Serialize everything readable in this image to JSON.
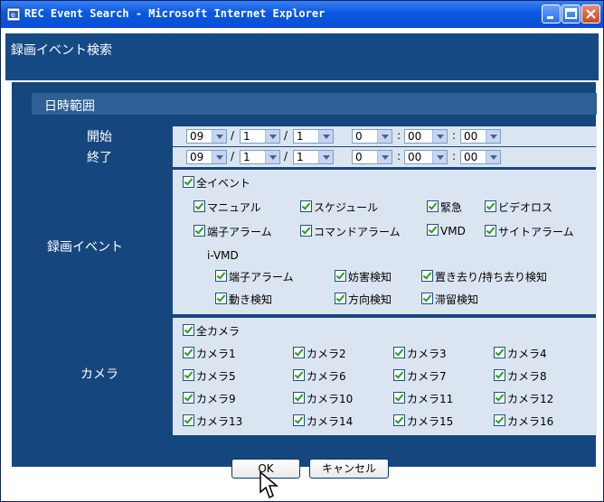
{
  "window": {
    "title": "REC Event Search - Microsoft Internet Explorer"
  },
  "page": {
    "title": "録画イベント検索"
  },
  "section": {
    "title": "日時範囲"
  },
  "rows": {
    "start_label": "開始",
    "end_label": "終了",
    "events_label": "録画イベント",
    "camera_label": "カメラ"
  },
  "start": {
    "year": "09",
    "month": "1",
    "day": "1",
    "hour": "0",
    "minute": "00",
    "second": "00"
  },
  "end": {
    "year": "09",
    "month": "1",
    "day": "1",
    "hour": "0",
    "minute": "00",
    "second": "00"
  },
  "separators": {
    "slash": "/",
    "colon": ":"
  },
  "events": {
    "all": "全イベント",
    "manual": "マニュアル",
    "schedule": "スケジュール",
    "emergency": "緊急",
    "video_loss": "ビデオロス",
    "terminal_alarm": "端子アラーム",
    "command_alarm": "コマンドアラーム",
    "vmd": "VMD",
    "site_alarm": "サイトアラーム",
    "ivmd_label": "i-VMD",
    "ivmd_terminal_alarm": "端子アラーム",
    "obstruction": "妨害検知",
    "left_removed": "置き去り/持ち去り検知",
    "motion": "動き検知",
    "direction": "方向検知",
    "loitering": "滞留検知"
  },
  "cameras": {
    "all": "全カメラ",
    "list": [
      "カメラ1",
      "カメラ2",
      "カメラ3",
      "カメラ4",
      "カメラ5",
      "カメラ6",
      "カメラ7",
      "カメラ8",
      "カメラ9",
      "カメラ10",
      "カメラ11",
      "カメラ12",
      "カメラ13",
      "カメラ14",
      "カメラ15",
      "カメラ16"
    ]
  },
  "buttons": {
    "ok": "OK",
    "cancel": "キャンセル"
  },
  "colors": {
    "panel": "#15477e",
    "section": "#2e5f95",
    "lightbox": "#dbe5f1",
    "titlebar": "#0a58e0"
  }
}
